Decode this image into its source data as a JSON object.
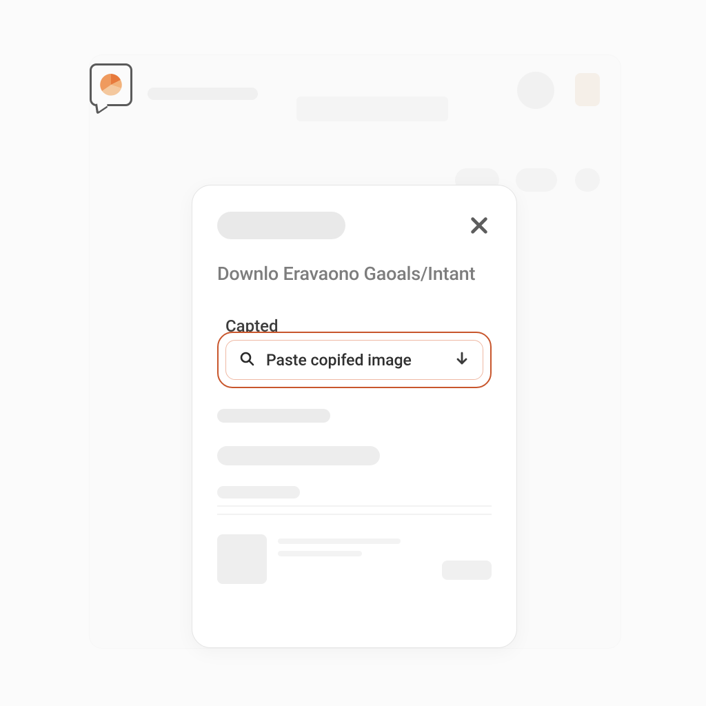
{
  "logo": {
    "name": "chat-pie-logo"
  },
  "modal": {
    "heading": "Downlo Eravaono Gaoals/Intant",
    "close_label": "Close",
    "field": {
      "label": "Capted",
      "placeholder": "Paste copifed image"
    }
  }
}
